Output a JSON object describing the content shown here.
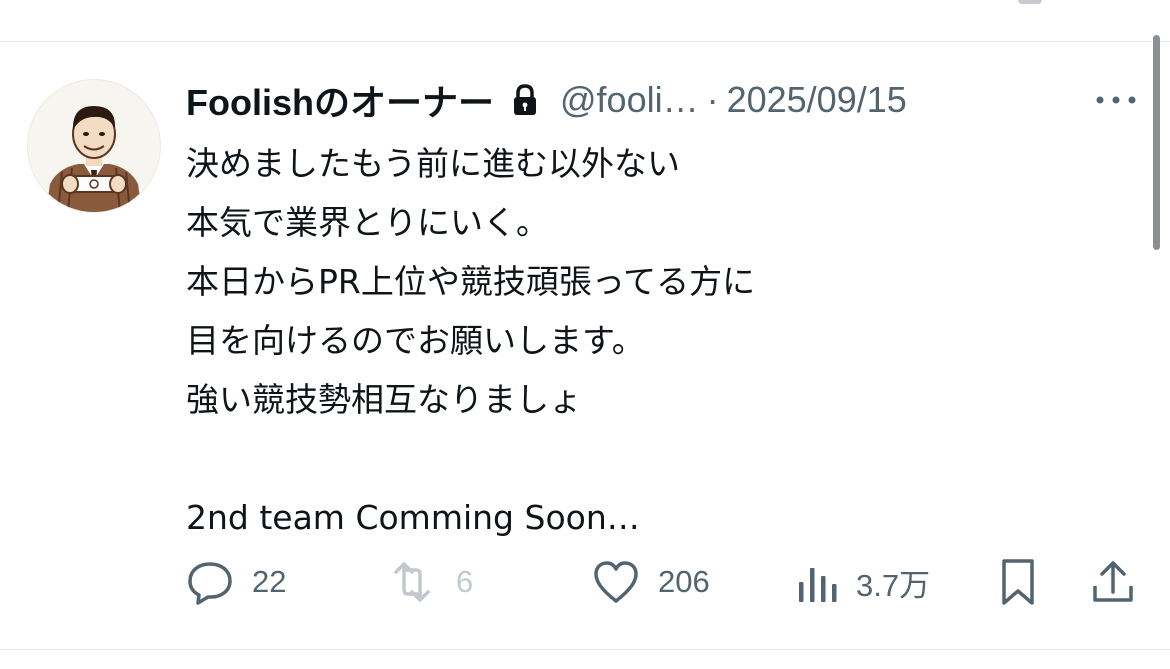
{
  "author": {
    "display_name": "Foolishのオーナー",
    "handle": "@fooli…",
    "separator": "·",
    "date": "2025/09/15",
    "protected_icon": "lock-icon",
    "avatar_icon": "avatar-illustration"
  },
  "post": {
    "lines": [
      "決めましたもう前に進む以外ない",
      "本気で業界とりにいく。",
      "本日からPR上位や競技頑張ってる方に",
      "目を向けるのでお願いします。",
      "強い競技勢相互なりましょ",
      "",
      "2nd team Comming Soon…"
    ]
  },
  "actions": {
    "reply": {
      "icon": "reply-icon",
      "count": "22"
    },
    "repost": {
      "icon": "repost-icon",
      "count": "6"
    },
    "like": {
      "icon": "heart-icon",
      "count": "206"
    },
    "views": {
      "icon": "views-icon",
      "count": "3.7万"
    },
    "bookmark": {
      "icon": "bookmark-icon"
    },
    "share": {
      "icon": "share-icon"
    }
  },
  "more_icon": "more-icon",
  "colors": {
    "text": "#0f1419",
    "secondary": "#536471",
    "divider": "#e6e9ec"
  }
}
